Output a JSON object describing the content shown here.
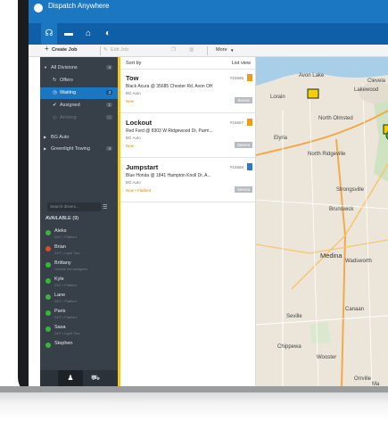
{
  "app": {
    "title": "Dispatch Anywhere"
  },
  "toolbar": {
    "create_job": "Create Job",
    "edit_job": "Edit Job",
    "more": "More"
  },
  "sidebar": {
    "items": [
      {
        "label": "All Divisions",
        "count": "4"
      },
      {
        "label": "Offers",
        "count": ""
      },
      {
        "label": "Waiting",
        "count": "3"
      },
      {
        "label": "Assigned",
        "count": "1"
      },
      {
        "label": "Arriving",
        "count": "1"
      },
      {
        "label": "BG Auto",
        "count": ""
      },
      {
        "label": "Greenlight Towing",
        "count": "4"
      }
    ],
    "search_placeholder": "Search drivers...",
    "available_header": "AVAILABLE (9)",
    "drivers": [
      {
        "name": "Aleks",
        "sub": "24/7 • Flatbed",
        "color": "#3bb43b"
      },
      {
        "name": "Brian",
        "sub": "24/7 • Light Tow",
        "color": "#e04a2a"
      },
      {
        "name": "Brittany",
        "sub": "Vehicle not assigned",
        "color": "#3bb43b"
      },
      {
        "name": "Kyle",
        "sub": "24/7 • Flatbed",
        "color": "#3bb43b"
      },
      {
        "name": "Lane",
        "sub": "24/7 • Flatbed",
        "color": "#3bb43b"
      },
      {
        "name": "Paris",
        "sub": "24/7 • Flatbed",
        "color": "#3bb43b"
      },
      {
        "name": "Sasa",
        "sub": "24/7 • Light Tow",
        "color": "#3bb43b"
      },
      {
        "name": "Stephen",
        "sub": "",
        "color": "#3bb43b"
      }
    ]
  },
  "joblist": {
    "sort_label": "Sort by",
    "view_label": "List view",
    "jobs": [
      {
        "type": "Tow",
        "number": "#15666",
        "address": "Black Acura @ 35685 Chester Rd, Avon OH",
        "account": "BG Auto",
        "status": "New",
        "tag": "Bessie",
        "flag": "#f39c12"
      },
      {
        "type": "Lockout",
        "number": "#15667",
        "address": "Red Ford @ 8303 W Ridgewood Dr, Parm...",
        "account": "BG Auto",
        "status": "New",
        "tag": "Sienna",
        "flag": "#f39c12"
      },
      {
        "type": "Jumpstart",
        "number": "#15668",
        "address": "Blue Honda @ 1841 Hampton Knoll Dr, A...",
        "account": "BG Auto",
        "status": "New • Flatbed",
        "tag": "Sienna",
        "flag": "#2a7bc8"
      }
    ]
  },
  "map": {
    "labels": [
      "Avon Lake",
      "Clevela",
      "Lakewood",
      "Lorain",
      "North Olmsted",
      "Elyria",
      "North Ridgeville",
      "Strongsville",
      "Brunswick",
      "Medina",
      "Wadsworth",
      "Canaan",
      "Seville",
      "Chippewa",
      "Wooster",
      "Orrville",
      "Ma"
    ]
  }
}
